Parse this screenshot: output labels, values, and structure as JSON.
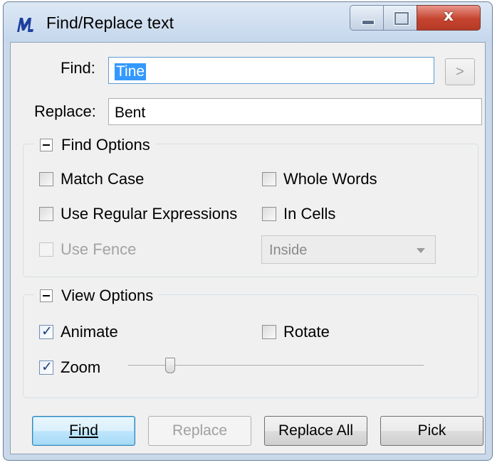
{
  "window": {
    "title": "Find/Replace text",
    "close_label": "x"
  },
  "find": {
    "label": "Find:",
    "value": "Tine",
    "next_label": ">"
  },
  "replace": {
    "label": "Replace:",
    "value": "Bent"
  },
  "find_options": {
    "heading": "Find Options",
    "match_case": {
      "label": "Match Case",
      "checked": false
    },
    "whole_words": {
      "label": "Whole Words",
      "checked": false
    },
    "regex": {
      "label": "Use Regular Expressions",
      "checked": false
    },
    "in_cells": {
      "label": "In Cells",
      "checked": false
    },
    "use_fence": {
      "label": "Use Fence",
      "checked": false,
      "enabled": false
    },
    "fence_mode": {
      "value": "Inside"
    }
  },
  "view_options": {
    "heading": "View Options",
    "animate": {
      "label": "Animate",
      "checked": true
    },
    "rotate": {
      "label": "Rotate",
      "checked": false
    },
    "zoom": {
      "label": "Zoom",
      "checked": true,
      "slider_level": 0.13
    }
  },
  "buttons": {
    "find": "Find",
    "replace": "Replace",
    "replace_all": "Replace All",
    "pick": "Pick"
  }
}
